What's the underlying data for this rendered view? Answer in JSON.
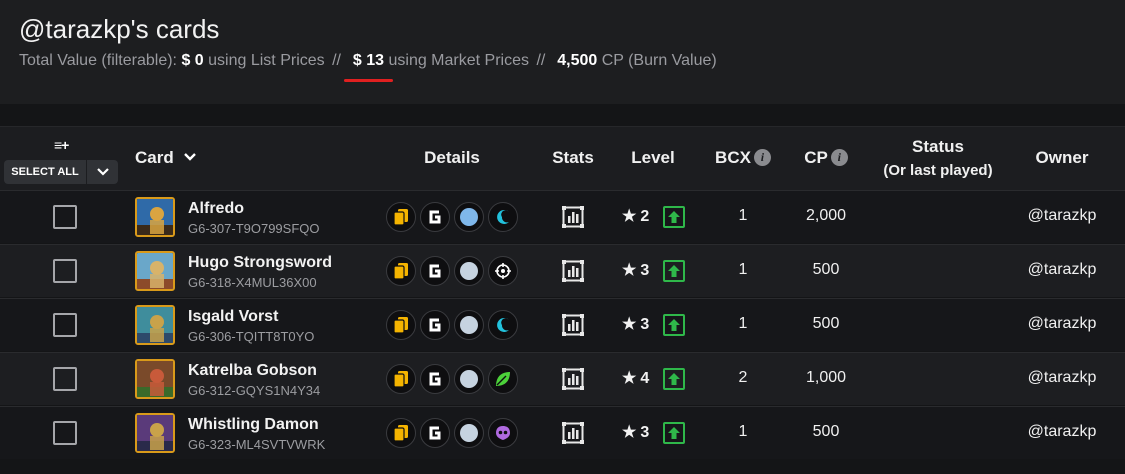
{
  "header": {
    "title": "@tarazkp's cards",
    "total_label": "Total Value (filterable):",
    "list_value": "$ 0",
    "list_label": "using List Prices",
    "sep": "//",
    "market_value": "$ 13",
    "market_label": "using Market Prices",
    "cp_value": "4,500",
    "cp_label": "CP (Burn Value)"
  },
  "table": {
    "select_icon": "≡+",
    "select_all": "SELECT ALL",
    "columns": {
      "card": "Card",
      "details": "Details",
      "stats": "Stats",
      "level": "Level",
      "bcx": "BCX",
      "cp": "CP",
      "status": "Status",
      "status_sub": "(Or last played)",
      "owner": "Owner"
    },
    "info_glyph": "i",
    "rows": [
      {
        "name": "Alfredo",
        "uid": "G6-307-T9O799SFQO",
        "level": "2",
        "bcx": "1",
        "cp": "2,000",
        "owner": "@tarazkp",
        "element": "water",
        "element_color": "#22c1dc"
      },
      {
        "name": "Hugo Strongsword",
        "uid": "G6-318-X4MUL36X00",
        "level": "3",
        "bcx": "1",
        "cp": "500",
        "owner": "@tarazkp",
        "element": "neutral",
        "element_color": "#ffffff"
      },
      {
        "name": "Isgald Vorst",
        "uid": "G6-306-TQITT8T0YO",
        "level": "3",
        "bcx": "1",
        "cp": "500",
        "owner": "@tarazkp",
        "element": "water",
        "element_color": "#22c1dc"
      },
      {
        "name": "Katrelba Gobson",
        "uid": "G6-312-GQYS1N4Y34",
        "level": "4",
        "bcx": "2",
        "cp": "1,000",
        "owner": "@tarazkp",
        "element": "earth",
        "element_color": "#4cd23a"
      },
      {
        "name": "Whistling Damon",
        "uid": "G6-323-ML4SVTVWRK",
        "level": "3",
        "bcx": "1",
        "cp": "500",
        "owner": "@tarazkp",
        "element": "death",
        "element_color": "#b06ae0"
      }
    ]
  },
  "icons": {
    "rarity": "card-stack-icon",
    "foil": "gold-g-icon",
    "stats": "stats-chart-icon",
    "upgrade": "level-up-icon",
    "star": "star-icon"
  },
  "colors": {
    "accent_red": "#e02020",
    "rarity_gold": "#f5b400",
    "upgrade_green": "#2fb84a",
    "thumb_border": "#d99a1a"
  }
}
